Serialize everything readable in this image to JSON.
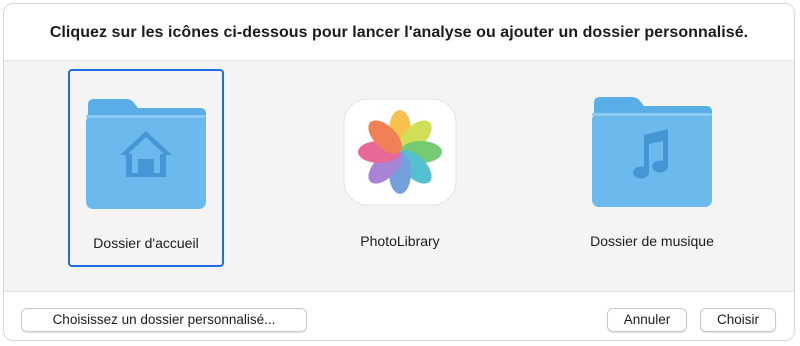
{
  "dialog": {
    "prompt": "Cliquez sur les icônes ci-dessous pour lancer l'analyse ou ajouter un dossier personnalisé."
  },
  "locations": [
    {
      "label": "Dossier d'accueil",
      "icon": "home-folder-icon",
      "selected": true
    },
    {
      "label": "PhotoLibrary",
      "icon": "photos-app-icon",
      "selected": false
    },
    {
      "label": "Dossier de musique",
      "icon": "music-folder-icon",
      "selected": false
    }
  ],
  "buttons": {
    "custom_folder": "Choisissez un dossier personnalisé...",
    "cancel": "Annuler",
    "choose": "Choisir"
  },
  "colors": {
    "selection": "#1f6ee0",
    "folder_body": "#6cb9ee",
    "folder_tab": "#5aaee8",
    "folder_glyph": "#4596d4"
  }
}
